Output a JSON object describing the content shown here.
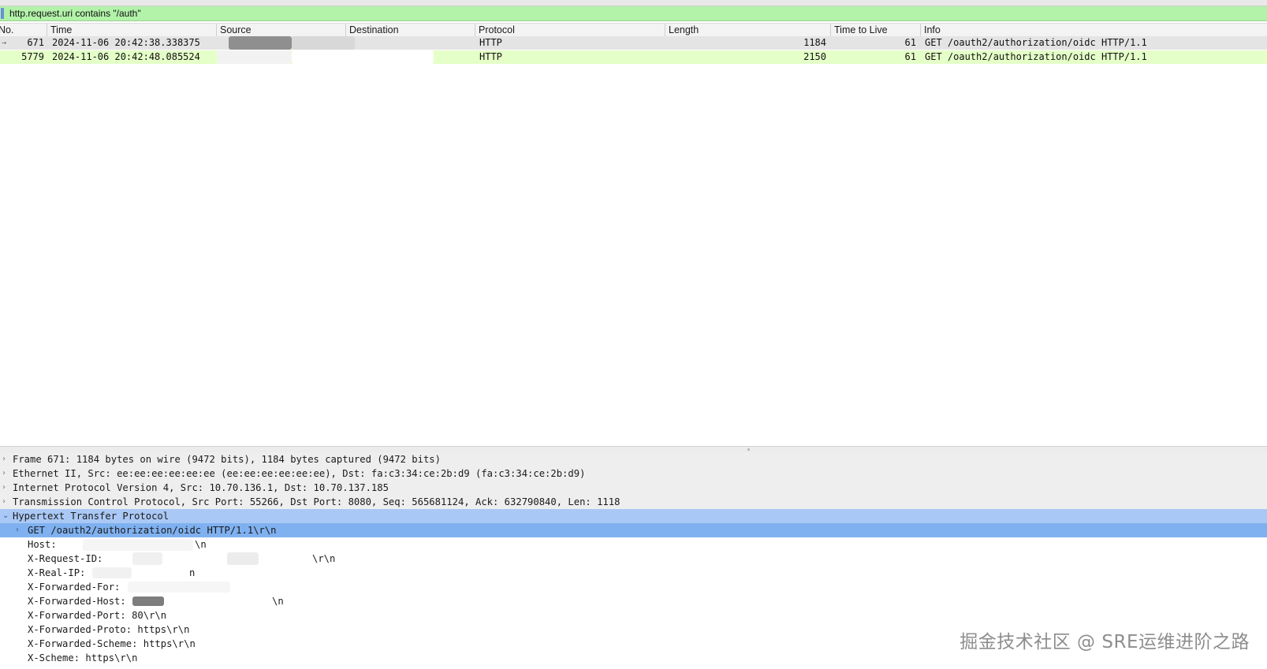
{
  "filter": {
    "expression": "http.request.uri contains \"/auth\""
  },
  "columns": [
    {
      "label": "No."
    },
    {
      "label": "Time"
    },
    {
      "label": "Source"
    },
    {
      "label": "Destination"
    },
    {
      "label": "Protocol"
    },
    {
      "label": "Length"
    },
    {
      "label": "Time to Live"
    },
    {
      "label": "Info"
    }
  ],
  "packets": [
    {
      "no": "671",
      "time": "2024-11-06 20:42:38.338375",
      "protocol": "HTTP",
      "length": "1184",
      "ttl": "61",
      "info": "GET /oauth2/authorization/oidc HTTP/1.1"
    },
    {
      "no": "5779",
      "time": "2024-11-06 20:42:48.085524",
      "protocol": "HTTP",
      "length": "2150",
      "ttl": "61",
      "info": "GET /oauth2/authorization/oidc HTTP/1.1"
    }
  ],
  "details": {
    "frame": "Frame 671: 1184 bytes on wire (9472 bits), 1184 bytes captured (9472 bits)",
    "ethernet": "Ethernet II, Src: ee:ee:ee:ee:ee:ee (ee:ee:ee:ee:ee:ee), Dst: fa:c3:34:ce:2b:d9 (fa:c3:34:ce:2b:d9)",
    "ip": "Internet Protocol Version 4, Src: 10.70.136.1, Dst: 10.70.137.185",
    "tcp": "Transmission Control Protocol, Src Port: 55266, Dst Port: 8080, Seq: 565681124, Ack: 632790840, Len: 1118",
    "http": "Hypertext Transfer Protocol",
    "http_fields": {
      "request_line": "GET /oauth2/authorization/oidc HTTP/1.1\\r\\n",
      "host_label": "Host:",
      "host_tail": "\\n",
      "request_id_label": "X-Request-ID:",
      "request_id_tail": "\\r\\n",
      "real_ip_label": "X-Real-IP:",
      "real_ip_tail": "n",
      "forwarded_for_label": "X-Forwarded-For:",
      "forwarded_host_label": "X-Forwarded-Host:",
      "forwarded_host_tail": "\\n",
      "forwarded_port": "X-Forwarded-Port: 80\\r\\n",
      "forwarded_proto": "X-Forwarded-Proto: https\\r\\n",
      "forwarded_scheme": "X-Forwarded-Scheme: https\\r\\n",
      "scheme": "X-Scheme: https\\r\\n"
    }
  },
  "watermark": "掘金技术社区 @ SRE运维进阶之路",
  "colors": {
    "filter_bg": "#b2f2a9",
    "row_selected_gray": "#e4e4e4",
    "row_http_green": "#e4ffc7",
    "detail_selected_blue": "#7fb1f0"
  }
}
